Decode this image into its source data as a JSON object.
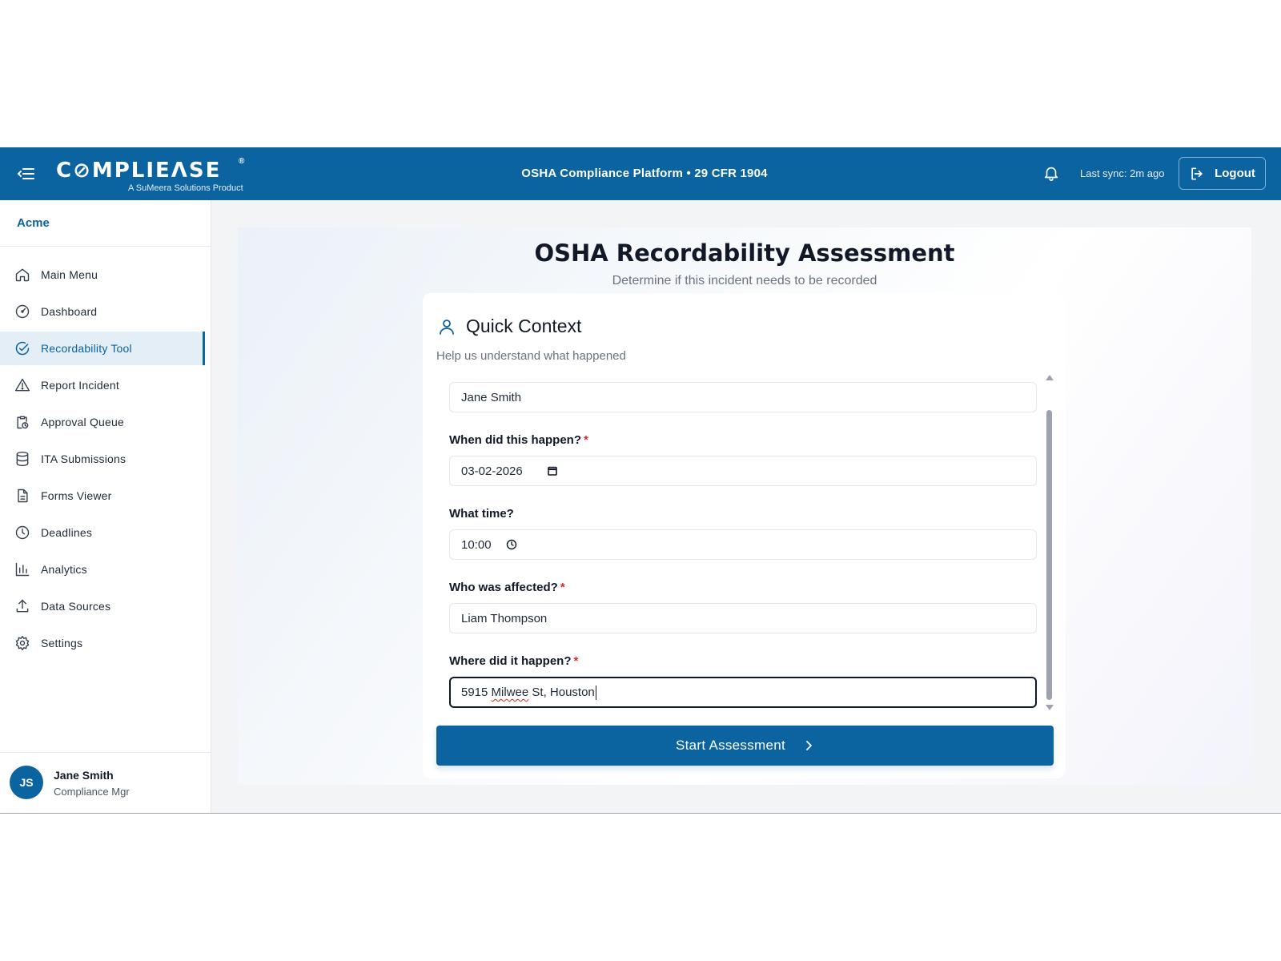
{
  "header": {
    "brand_name": "C⊘MPLIEΛSE",
    "brand_reg": "®",
    "brand_tagline": "A SuMeera Solutions Product",
    "platform_title": "OSHA Compliance Platform • 29 CFR 1904",
    "last_sync": "Last sync: 2m ago",
    "logout_label": "Logout"
  },
  "sidebar": {
    "org_name": "Acme",
    "items": [
      {
        "label": "Main Menu",
        "icon": "home-icon"
      },
      {
        "label": "Dashboard",
        "icon": "gauge-icon"
      },
      {
        "label": "Recordability Tool",
        "icon": "check-circle-icon",
        "active": true
      },
      {
        "label": "Report Incident",
        "icon": "warning-icon"
      },
      {
        "label": "Approval Queue",
        "icon": "clipboard-clock-icon"
      },
      {
        "label": "ITA Submissions",
        "icon": "database-icon"
      },
      {
        "label": "Forms Viewer",
        "icon": "document-icon"
      },
      {
        "label": "Deadlines",
        "icon": "clock-icon"
      },
      {
        "label": "Analytics",
        "icon": "bar-chart-icon"
      },
      {
        "label": "Data Sources",
        "icon": "upload-icon"
      },
      {
        "label": "Settings",
        "icon": "gear-icon"
      }
    ],
    "user": {
      "initials": "JS",
      "name": "Jane Smith",
      "role": "Compliance Mgr"
    }
  },
  "main": {
    "title": "OSHA Recordability Assessment",
    "subtitle": "Determine if this incident needs to be recorded",
    "card": {
      "title": "Quick Context",
      "subtitle": "Help us understand what happened",
      "reporter_value": "Jane Smith",
      "date_label": "When did this happen?",
      "date_value": "03-02-2026",
      "time_label": "What time?",
      "time_value": "10:00",
      "affected_label": "Who was affected?",
      "affected_value": "Liam Thompson",
      "location_label": "Where did it happen?",
      "location_value_pre": "5915 ",
      "location_value_misspelled": "Milwee",
      "location_value_post": " St, Houston",
      "required_mark": "*",
      "start_label": "Start Assessment"
    }
  },
  "colors": {
    "primary": "#0b63a0",
    "required": "#dc2626",
    "active_bg": "#e3eef7"
  }
}
